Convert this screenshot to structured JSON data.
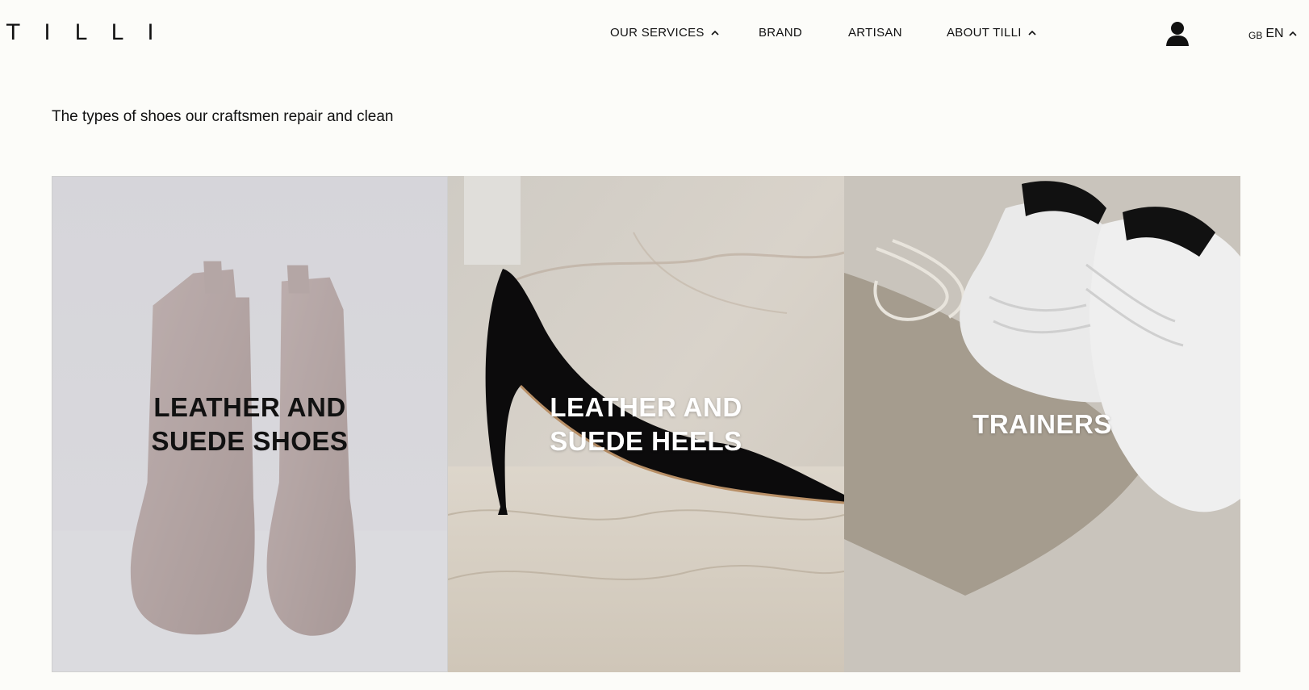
{
  "header": {
    "logo": "TILLI",
    "nav": [
      {
        "label": "OUR SERVICES",
        "has_dropdown": true
      },
      {
        "label": "BRAND",
        "has_dropdown": false
      },
      {
        "label": "ARTISAN",
        "has_dropdown": false
      },
      {
        "label": "ABOUT TILLI",
        "has_dropdown": true
      }
    ],
    "account_icon": "user-icon",
    "language": {
      "flag": "GB",
      "code": "EN"
    }
  },
  "main": {
    "intro": "The types of shoes our craftsmen repair and clean",
    "cards": [
      {
        "title": "LEATHER AND\nSUEDE SHOES",
        "image": "brown-leather-chelsea-boots"
      },
      {
        "title": "LEATHER AND\nSUEDE HEELS",
        "image": "black-suede-stiletto-heel"
      },
      {
        "title": "TRAINERS",
        "image": "white-leather-trainers-on-tilli-bag"
      }
    ]
  },
  "colors": {
    "background": "#fcfcf9",
    "text": "#111111",
    "card_overlay_text": "#ffffff"
  }
}
